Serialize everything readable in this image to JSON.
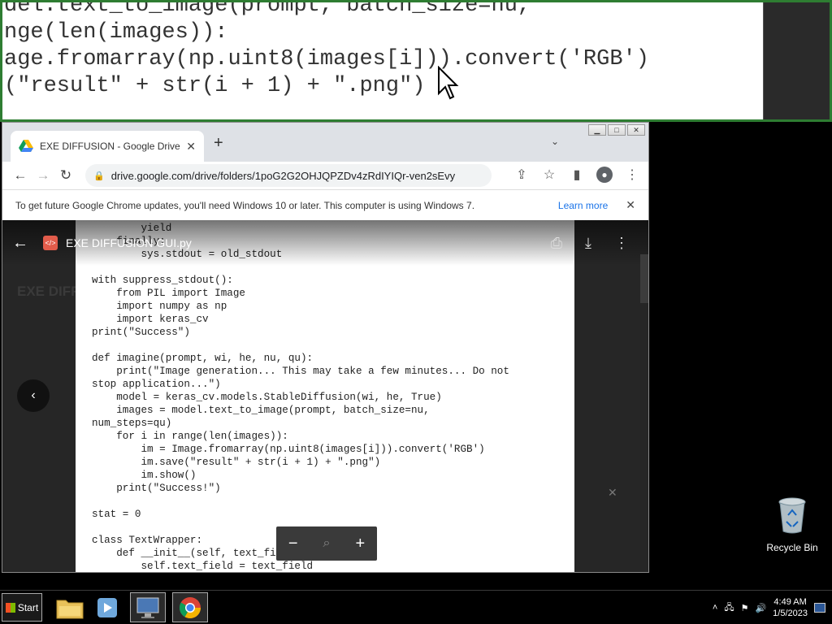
{
  "magnifier": {
    "lines": [
      "del.text_to_image(prompt, batch_size=nu,",
      "",
      "nge(len(images)):",
      "age.fromarray(np.uint8(images[i])).convert('RGB')",
      "(\"result\" + str(i + 1) + \".png\")"
    ]
  },
  "window_controls": {
    "minimize": "▁",
    "maximize": "□",
    "close": "✕"
  },
  "tab": {
    "title": "EXE DIFFUSION - Google Drive",
    "new_tab": "+",
    "dropdown": "⌄"
  },
  "toolbar": {
    "url": "drive.google.com/drive/folders/1poG2G2OHJQPZDv4zRdIYIQr-ven2sEvy"
  },
  "infobar": {
    "text": "To get future Google Chrome updates, you'll need Windows 10 or later. This computer is using Windows 7.",
    "learn_more": "Learn more"
  },
  "viewer": {
    "file_name": "EXE DIFFUSION GUI.py",
    "background_title": "EXE DIFF",
    "code": "        yield\n    finally:\n        sys.stdout = old_stdout\n\nwith suppress_stdout():\n    from PIL import Image\n    import numpy as np\n    import keras_cv\nprint(\"Success\")\n\ndef imagine(prompt, wi, he, nu, qu):\n    print(\"Image generation... This may take a few minutes... Do not\nstop application...\")\n    model = keras_cv.models.StableDiffusion(wi, he, True)\n    images = model.text_to_image(prompt, batch_size=nu,\nnum_steps=qu)\n    for i in range(len(images)):\n        im = Image.fromarray(np.uint8(images[i])).convert('RGB')\n        im.save(\"result\" + str(i + 1) + \".png\")\n        im.show()\n    print(\"Success!\")\n\nstat = 0\n\nclass TextWrapper:\n    def __init__(self, text_field):\n        self.text_field = text_field"
  },
  "desktop": {
    "recycle_bin": "Recycle Bin"
  },
  "taskbar": {
    "start": "Start",
    "time": "4:49 AM",
    "date": "1/5/2023"
  }
}
